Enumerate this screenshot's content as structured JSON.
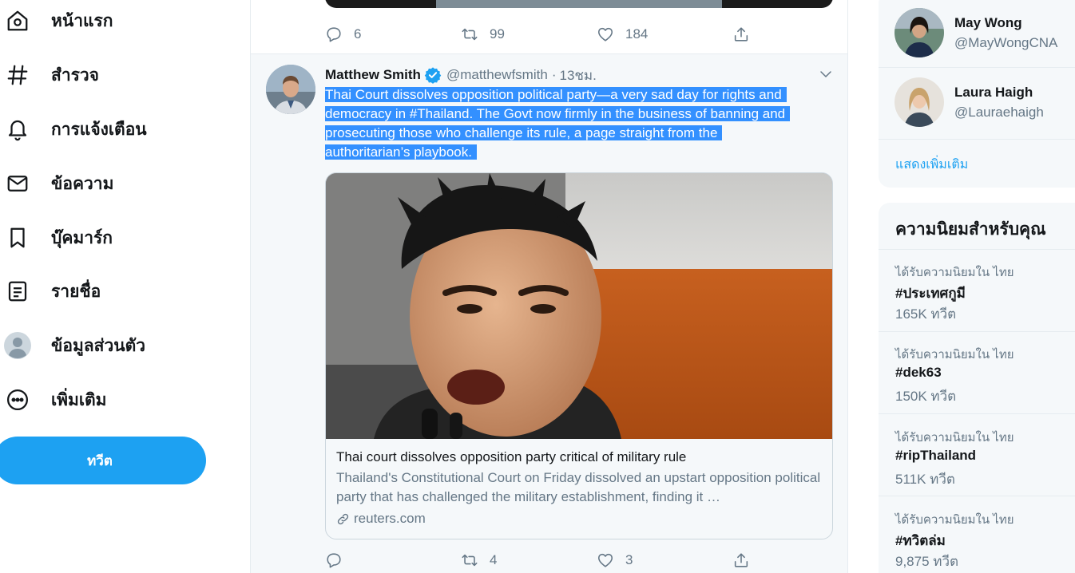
{
  "nav": {
    "items": [
      {
        "label": "หน้าแรก",
        "icon": "home-icon"
      },
      {
        "label": "สำรวจ",
        "icon": "hashtag-icon"
      },
      {
        "label": "การแจ้งเตือน",
        "icon": "bell-icon"
      },
      {
        "label": "ข้อความ",
        "icon": "mail-icon"
      },
      {
        "label": "บุ๊คมาร์ก",
        "icon": "bookmark-icon"
      },
      {
        "label": "รายชื่อ",
        "icon": "list-icon"
      },
      {
        "label": "ข้อมูลส่วนตัว",
        "icon": "profile-avatar-icon"
      },
      {
        "label": "เพิ่มเติม",
        "icon": "more-circle-icon"
      }
    ],
    "tweet_button": "ทวีต"
  },
  "prev_tweet": {
    "reply_count": "6",
    "retweet_count": "99",
    "like_count": "184"
  },
  "tweet": {
    "author_name": "Matthew Smith",
    "author_handle": "@matthewfsmith",
    "separator": "·",
    "time": "13ชม.",
    "text_lines": [
      "Thai Court dissolves opposition political party—a very sad day for rights and",
      "democracy in #Thailand. The Govt now firmly in the business of banning and",
      "prosecuting those who challenge its rule, a page straight from the",
      "authoritarian’s playbook."
    ],
    "card": {
      "title": "Thai court dissolves opposition party critical of military rule",
      "description": "Thailand's Constitutional Court on Friday dissolved an upstart opposition political party that has challenged the military establishment, finding it …",
      "domain": "reuters.com"
    },
    "reply_count": "",
    "retweet_count": "4",
    "like_count": "3"
  },
  "who_to_follow": {
    "users": [
      {
        "name": "May Wong",
        "handle": "@MayWongCNA"
      },
      {
        "name": "Laura Haigh",
        "handle": "@Lauraehaigh"
      }
    ],
    "show_more": "แสดงเพิ่มเติม"
  },
  "trends": {
    "title": "ความนิยมสำหรับคุณ",
    "items": [
      {
        "context": "ได้รับความนิยมใน ไทย",
        "tag": "#ประเทศกูมี",
        "count": "165K ทวีต"
      },
      {
        "context": "ได้รับความนิยมใน ไทย",
        "tag": "#dek63",
        "count": "150K ทวีต"
      },
      {
        "context": "ได้รับความนิยมใน ไทย",
        "tag": "#ripThailand",
        "count": "511K ทวีต"
      },
      {
        "context": "ได้รับความนิยมใน ไทย",
        "tag": "#ทวิตล่ม",
        "count": "9,875 ทวีต"
      }
    ]
  },
  "colors": {
    "accent": "#1da1f2",
    "selection": "#3390ff",
    "secondary_text": "#657786"
  }
}
